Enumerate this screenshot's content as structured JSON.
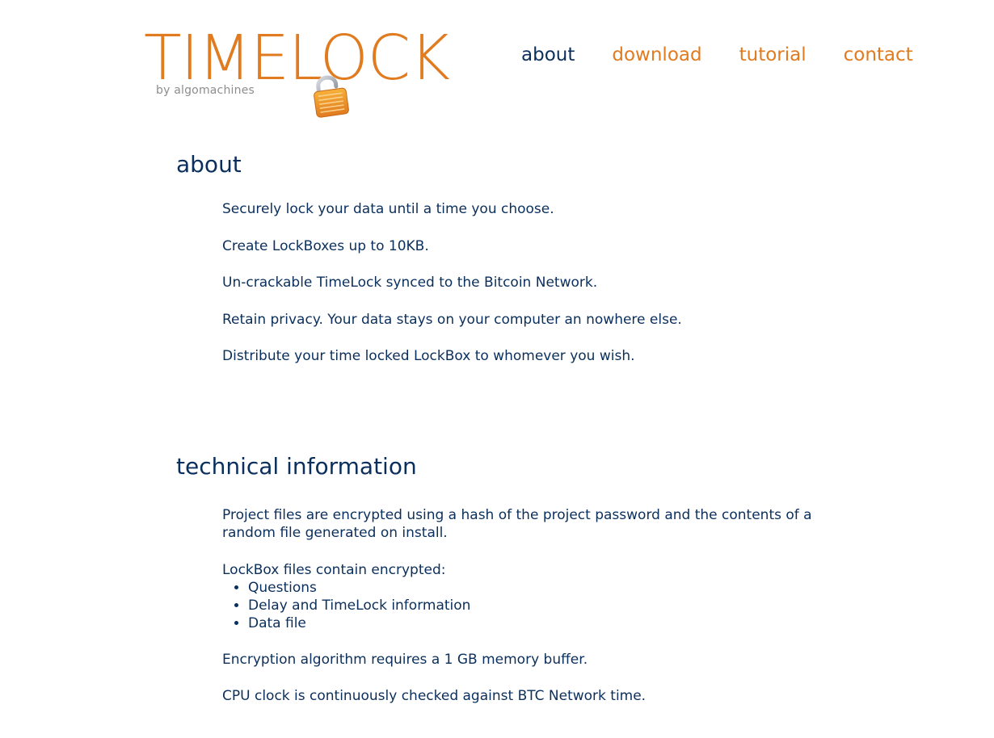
{
  "logo": {
    "wordmark": "TIMELOCK",
    "byline": "by algomachines",
    "padlock_icon": "padlock-icon",
    "brand_color": "#e07b20"
  },
  "nav": {
    "items": [
      {
        "label": "about",
        "active": true
      },
      {
        "label": "download",
        "active": false
      },
      {
        "label": "tutorial",
        "active": false
      },
      {
        "label": "contact",
        "active": false
      }
    ],
    "active_color": "#0a2f5c",
    "link_color": "#e07b20"
  },
  "about": {
    "title": "about",
    "paragraphs": [
      "Securely lock your data until a time you choose.",
      "Create LockBoxes up to 10KB.",
      "Un-crackable TimeLock synced to the Bitcoin Network.",
      "Retain privacy. Your data stays on your computer an nowhere else.",
      "Distribute your time locked LockBox to whomever you wish."
    ]
  },
  "technical": {
    "title": "technical information",
    "intro": "Project files are encrypted using a hash of the project password and the contents of a random file generated on install.",
    "lockbox_heading": "LockBox files contain encrypted:",
    "lockbox_items": [
      "Questions",
      "Delay and TimeLock information",
      "Data file"
    ],
    "memory_note": "Encryption algorithm requires a 1 GB memory buffer.",
    "clock_note": "CPU clock is continuously checked against BTC Network time."
  }
}
